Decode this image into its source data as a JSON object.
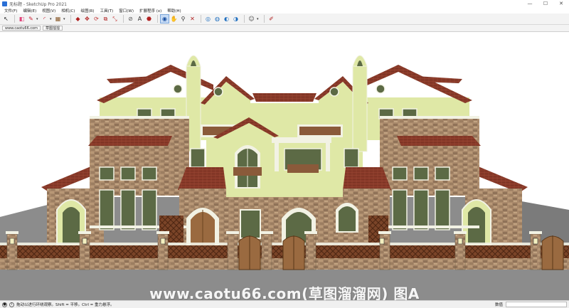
{
  "window": {
    "title": "无标题 - SketchUp Pro 2021",
    "controls": {
      "minimize": "—",
      "maximize": "☐",
      "close": "✕"
    }
  },
  "menu": [
    "文件(F)",
    "编辑(E)",
    "视图(V)",
    "相机(C)",
    "绘图(R)",
    "工具(T)",
    "窗口(W)",
    "扩展程序 (x)",
    "帮助(H)"
  ],
  "toolbar": {
    "icons": [
      "select-icon",
      "eraser-icon",
      "pencil-icon",
      "arc-icon",
      "shape-icon",
      "push-pull-icon",
      "move-icon",
      "rotate-icon",
      "offset-icon",
      "scale-icon",
      "tape-measure-icon",
      "text-icon",
      "paint-bucket-icon",
      "orbit-icon",
      "pan-icon",
      "zoom-icon",
      "zoom-extents-icon",
      "warehouse-icon",
      "extension-warehouse-icon",
      "layout-icon",
      "account-icon",
      "edit-icon"
    ],
    "active": "orbit-icon"
  },
  "scenes": {
    "tab_1": "www.caotu66.com",
    "tab_2": "草图溜溜"
  },
  "watermark": "www.caotu66.com(草图溜溜网) 图A",
  "status": {
    "hint": "拖动以进行环绕观察。Shift = 平移。Ctrl = 重力悬浮。",
    "measure_label": "数值"
  },
  "colors": {
    "stucco": "#dfe8a6",
    "stone": "#a9896b",
    "roof": "#8b3b2a",
    "trim": "#f2f2e4",
    "door": "#9a6a40",
    "fence": "#6e3a22",
    "ground": "#8a8a8a"
  }
}
